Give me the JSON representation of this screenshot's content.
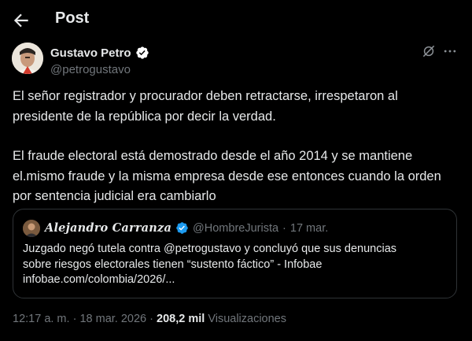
{
  "header": {
    "back_icon": "arrow-left-icon",
    "title": "Post"
  },
  "tweet": {
    "author_name": "Gustavo Petro",
    "author_handle": "@petrogustavo",
    "verified_color": "#1d9bf0",
    "paragraph_1": "El señor registrador y procurador deben retractarse, irrespetaron al presidente de la  república por decir la verdad.",
    "paragraph_2": "El fraude electoral está demostrado desde el año 2014 y se mantiene el.mismo fraude y la misma empresa desde ese entonces cuando la orden por sentencia judicial era cambiarlo",
    "grok_icon": "grok-icon",
    "more_icon": "more-dots-icon"
  },
  "quote": {
    "name": "Alejandro Carranza",
    "handle": "@HombreJurista",
    "separator": "·",
    "date": "17 mar.",
    "text_line_1": "Juzgado negó tutela contra @petrogustavo y concluyó que sus denuncias",
    "text_line_2": "sobre riesgos electorales tienen “sustento fáctico” - Infobae",
    "text_line_3": "infobae.com/colombia/2026/..."
  },
  "meta": {
    "time": "12:17 a. m.",
    "separator": "·",
    "date": "18 mar. 2026",
    "views_count": "208,2 mil",
    "views_label": "Visualizaciones"
  },
  "colors": {
    "background": "#000000",
    "text": "#e7e9ea",
    "secondary": "#71767b",
    "border": "#2f3336",
    "accent": "#1d9bf0"
  }
}
